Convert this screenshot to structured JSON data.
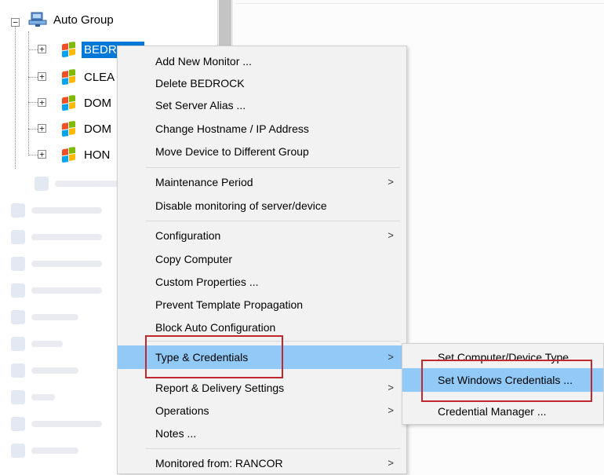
{
  "tree": {
    "root": {
      "label": "Auto Group",
      "expander": "−"
    },
    "devices": [
      {
        "label": "BEDROCK",
        "visible_text": "BEDROCK",
        "expander": "+",
        "selected": true
      },
      {
        "label": "CLEA",
        "visible_text": "CLEA",
        "expander": "+",
        "selected": false
      },
      {
        "label": "DOM",
        "visible_text": "DOM",
        "expander": "+",
        "selected": false
      },
      {
        "label": "DOM",
        "visible_text": "DOM",
        "expander": "+",
        "selected": false
      },
      {
        "label": "HON",
        "visible_text": "HON",
        "expander": "+",
        "selected": false
      }
    ]
  },
  "context_menu": {
    "items": [
      {
        "label": "Add New Monitor ..."
      },
      {
        "label": "Delete BEDROCK"
      },
      {
        "label": "Set Server Alias ..."
      },
      {
        "label": "Change Hostname / IP Address"
      },
      {
        "label": "Move Device to Different Group"
      },
      {
        "label": "Maintenance Period",
        "arrow": ">"
      },
      {
        "label": "Disable monitoring of server/device"
      },
      {
        "label": "Configuration",
        "arrow": ">"
      },
      {
        "label": "Copy Computer"
      },
      {
        "label": "Custom Properties ..."
      },
      {
        "label": "Prevent Template Propagation"
      },
      {
        "label": "Block Auto Configuration"
      },
      {
        "label": "Type & Credentials",
        "arrow": ">",
        "highlighted": true
      },
      {
        "label": "Report & Delivery Settings",
        "arrow": ">"
      },
      {
        "label": "Operations",
        "arrow": ">"
      },
      {
        "label": "Notes ..."
      },
      {
        "label": "Monitored from: RANCOR",
        "arrow": ">"
      }
    ]
  },
  "submenu": {
    "items": [
      {
        "label": "Set Computer/Device Type"
      },
      {
        "label": "Set Windows Credentials ...",
        "highlighted": true
      },
      {
        "label": "Credential Manager ..."
      }
    ]
  },
  "colors": {
    "selection": "#0078d7",
    "menu_highlight": "#91c9f7",
    "menu_background": "#f2f2f2",
    "annotation": "#c0282d"
  },
  "icons": {
    "root": "network-group-icon",
    "device": "windows-logo-icon",
    "submenu_arrow": "chevron-right-icon"
  }
}
